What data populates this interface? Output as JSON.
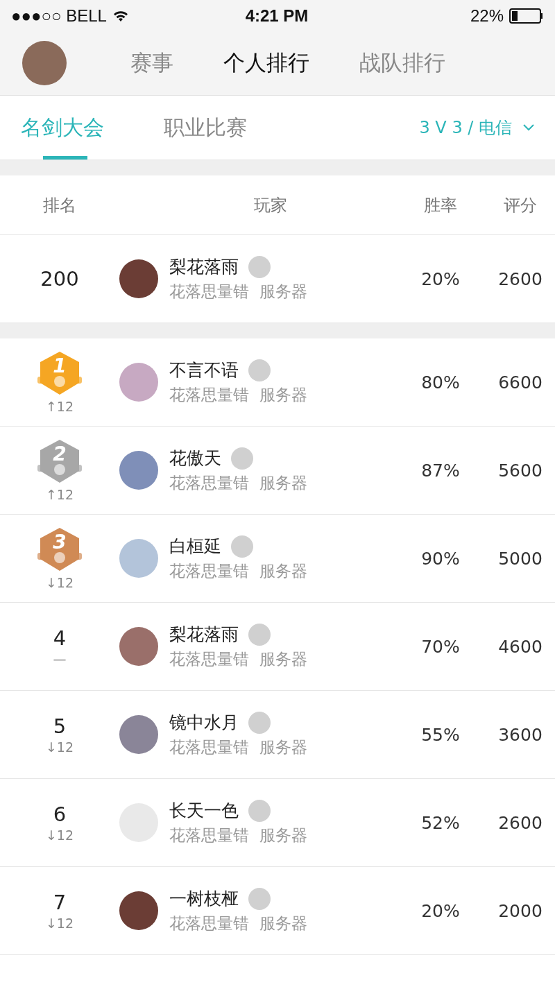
{
  "status_bar": {
    "carrier": "●●●○○ BELL",
    "time": "4:21 PM",
    "battery": "22%"
  },
  "nav_tabs": [
    {
      "label": "赛事",
      "selected": false
    },
    {
      "label": "个人排行",
      "selected": true
    },
    {
      "label": "战队排行",
      "selected": false
    }
  ],
  "sub_tabs": [
    {
      "label": "名剑大会",
      "selected": true
    },
    {
      "label": "职业比赛",
      "selected": false
    }
  ],
  "filter": {
    "label": "3 V 3 / 电信"
  },
  "columns": [
    "排名",
    "玩家",
    "胜率",
    "评分"
  ],
  "my_row": {
    "kind": "plain",
    "rank": "200",
    "name": "梨花落雨",
    "server": "花落思量错  服务器",
    "win_rate": "20%",
    "score": "2600"
  },
  "rows": [
    {
      "kind": "medal",
      "rank": "1",
      "color": "#f5a623",
      "change": "↑12",
      "name": "不言不语",
      "server": "花落思量错  服务器",
      "win_rate": "80%",
      "score": "6600"
    },
    {
      "kind": "medal",
      "rank": "2",
      "color": "#a7a7a7",
      "change": "↑12",
      "name": "花傲天",
      "server": "花落思量错  服务器",
      "win_rate": "87%",
      "score": "5600"
    },
    {
      "kind": "medal",
      "rank": "3",
      "color": "#d08a55",
      "change": "↓12",
      "name": "白桓延",
      "server": "花落思量错  服务器",
      "win_rate": "90%",
      "score": "5000"
    },
    {
      "kind": "plain",
      "rank": "4",
      "change": "—",
      "name": "梨花落雨",
      "server": "花落思量错  服务器",
      "win_rate": "70%",
      "score": "4600"
    },
    {
      "kind": "plain",
      "rank": "5",
      "change": "↓12",
      "name": "镜中水月",
      "server": "花落思量错  服务器",
      "win_rate": "55%",
      "score": "3600"
    },
    {
      "kind": "plain",
      "rank": "6",
      "change": "↓12",
      "name": "长天一色",
      "server": "花落思量错  服务器",
      "win_rate": "52%",
      "score": "2600"
    },
    {
      "kind": "plain",
      "rank": "7",
      "change": "↓12",
      "name": "一树枝桠",
      "server": "花落思量错  服务器",
      "win_rate": "20%",
      "score": "2000"
    }
  ]
}
